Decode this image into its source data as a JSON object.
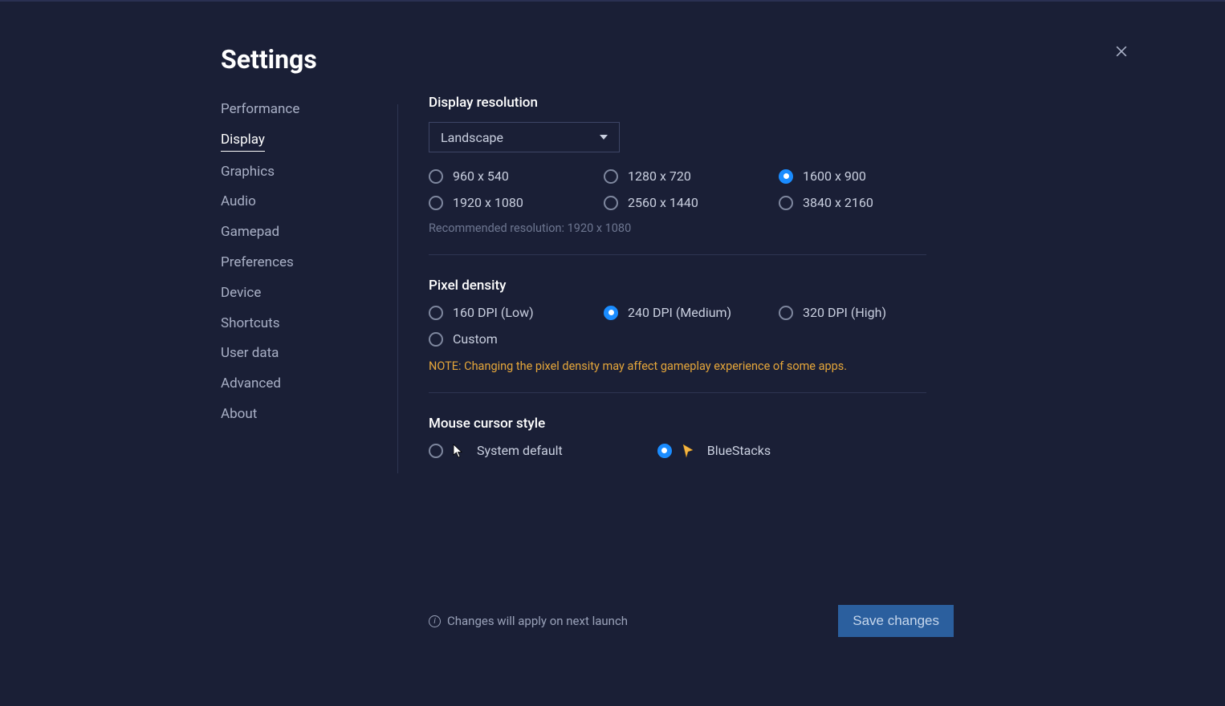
{
  "title": "Settings",
  "sidebar": {
    "items": [
      {
        "label": "Performance",
        "active": false
      },
      {
        "label": "Display",
        "active": true
      },
      {
        "label": "Graphics",
        "active": false
      },
      {
        "label": "Audio",
        "active": false
      },
      {
        "label": "Gamepad",
        "active": false
      },
      {
        "label": "Preferences",
        "active": false
      },
      {
        "label": "Device",
        "active": false
      },
      {
        "label": "Shortcuts",
        "active": false
      },
      {
        "label": "User data",
        "active": false
      },
      {
        "label": "Advanced",
        "active": false
      },
      {
        "label": "About",
        "active": false
      }
    ]
  },
  "display": {
    "resolution_title": "Display resolution",
    "orientation_selected": "Landscape",
    "resolutions": [
      {
        "label": "960 x 540",
        "selected": false
      },
      {
        "label": "1280 x 720",
        "selected": false
      },
      {
        "label": "1600 x 900",
        "selected": true
      },
      {
        "label": "1920 x 1080",
        "selected": false
      },
      {
        "label": "2560 x 1440",
        "selected": false
      },
      {
        "label": "3840 x 2160",
        "selected": false
      }
    ],
    "recommended_text": "Recommended resolution: 1920 x 1080"
  },
  "pixel_density": {
    "title": "Pixel density",
    "options": [
      {
        "label": "160 DPI (Low)",
        "selected": false
      },
      {
        "label": "240 DPI (Medium)",
        "selected": true
      },
      {
        "label": "320 DPI (High)",
        "selected": false
      },
      {
        "label": "Custom",
        "selected": false
      }
    ],
    "note": "NOTE: Changing the pixel density may affect gameplay experience of some apps."
  },
  "cursor_style": {
    "title": "Mouse cursor style",
    "options": [
      {
        "label": "System default",
        "selected": false,
        "icon": "system"
      },
      {
        "label": "BlueStacks",
        "selected": true,
        "icon": "bluestacks"
      }
    ]
  },
  "footer": {
    "note": "Changes will apply on next launch",
    "save_label": "Save changes"
  }
}
